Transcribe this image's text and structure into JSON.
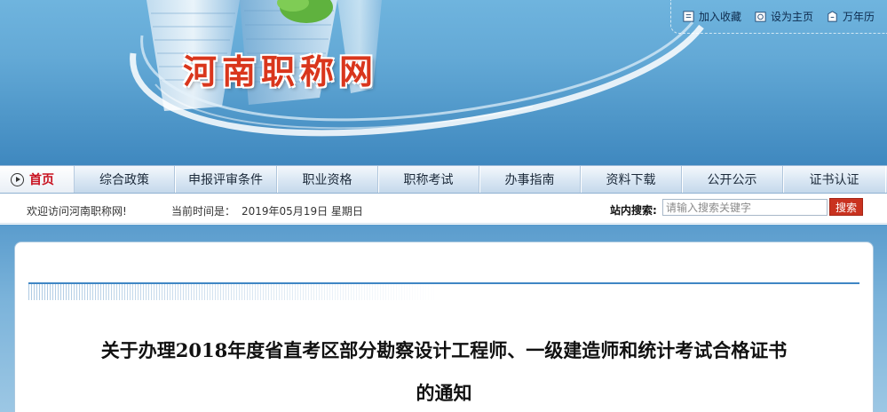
{
  "header": {
    "site_title": "河南职称网",
    "links": [
      {
        "label": "加入收藏",
        "icon": "bookmark-icon"
      },
      {
        "label": "设为主页",
        "icon": "home-page-icon"
      },
      {
        "label": "万年历",
        "icon": "calendar-icon"
      }
    ]
  },
  "nav": {
    "home": "首页",
    "items": [
      "综合政策",
      "申报评审条件",
      "职业资格",
      "职称考试",
      "办事指南",
      "资料下载",
      "公开公示",
      "证书认证"
    ]
  },
  "infobar": {
    "welcome": "欢迎访问河南职称网!",
    "time_label": "当前时间是：",
    "time_value": "2019年05月19日  星期日",
    "search_label": "站内搜索:",
    "search_placeholder": "请输入搜索关键字",
    "search_button": "搜索"
  },
  "article": {
    "title_line1": "关于办理2018年度省直考区部分勘察设计工程师、一级建造师和统计考试合格证书",
    "title_line2": "的通知"
  },
  "colors": {
    "accent_red": "#c9321f",
    "banner_blue": "#5ea4d4",
    "rule_blue": "#3f86c4"
  }
}
